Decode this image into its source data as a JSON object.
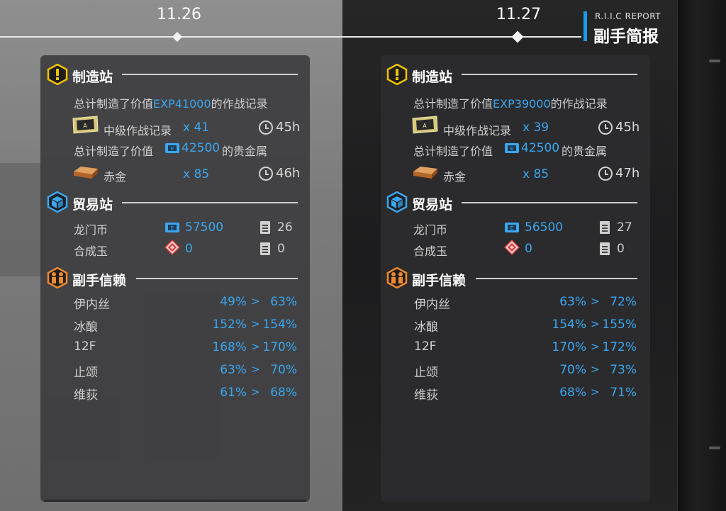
{
  "header": {
    "report_small": "R.I.I.C REPORT",
    "report_title": "副手简报"
  },
  "days": [
    {
      "date": "11.26",
      "factory": {
        "title": "制造站",
        "exp_prefix": "总计制造了价值",
        "exp_value": "EXP41000",
        "exp_suffix": "的作战记录",
        "record_name": "中级作战记录",
        "record_count": "x 41",
        "record_time": "45h",
        "gold_prefix": "总计制造了价值",
        "gold_value": "42500",
        "gold_suffix": "的贵金属",
        "gold_name": "赤金",
        "gold_count": "x 85",
        "gold_time": "46h"
      },
      "trade": {
        "title": "贸易站",
        "lmd_name": "龙门币",
        "lmd_value": "57500",
        "lmd_orders": "26",
        "orundum_name": "合成玉",
        "orundum_value": "0",
        "orundum_orders": "0"
      },
      "trust": {
        "title": "副手信赖",
        "rows": [
          {
            "name": "伊内丝",
            "from": "49%",
            "to": "63%"
          },
          {
            "name": "冰酿",
            "from": "152%",
            "to": "154%"
          },
          {
            "name": "12F",
            "from": "168%",
            "to": "170%"
          },
          {
            "name": "止颂",
            "from": "63%",
            "to": "70%"
          },
          {
            "name": "维荻",
            "from": "61%",
            "to": "68%"
          }
        ]
      }
    },
    {
      "date": "11.27",
      "factory": {
        "title": "制造站",
        "exp_prefix": "总计制造了价值",
        "exp_value": "EXP39000",
        "exp_suffix": "的作战记录",
        "record_name": "中级作战记录",
        "record_count": "x 39",
        "record_time": "45h",
        "gold_prefix": "总计制造了价值",
        "gold_value": "42500",
        "gold_suffix": "的贵金属",
        "gold_name": "赤金",
        "gold_count": "x 85",
        "gold_time": "47h"
      },
      "trade": {
        "title": "贸易站",
        "lmd_name": "龙门币",
        "lmd_value": "56500",
        "lmd_orders": "27",
        "orundum_name": "合成玉",
        "orundum_value": "0",
        "orundum_orders": "0"
      },
      "trust": {
        "title": "副手信赖",
        "rows": [
          {
            "name": "伊内丝",
            "from": "63%",
            "to": "72%"
          },
          {
            "name": "冰酿",
            "from": "154%",
            "to": "155%"
          },
          {
            "name": "12F",
            "from": "170%",
            "to": "172%"
          },
          {
            "name": "止颂",
            "from": "70%",
            "to": "73%"
          },
          {
            "name": "维荻",
            "from": "68%",
            "to": "71%"
          }
        ]
      }
    }
  ],
  "arrow_glyph": ">",
  "colors": {
    "accent": "#3aa6f0",
    "factory_icon": "#f2c200",
    "trade_icon": "#3aa6f0",
    "trust_icon": "#f08a30"
  },
  "icons": [
    "factory-warning-icon",
    "trade-box-icon",
    "trust-people-icon",
    "clock-icon",
    "document-icon",
    "lmd-icon",
    "orundum-icon",
    "battle-record-icon",
    "gold-bar-icon"
  ]
}
